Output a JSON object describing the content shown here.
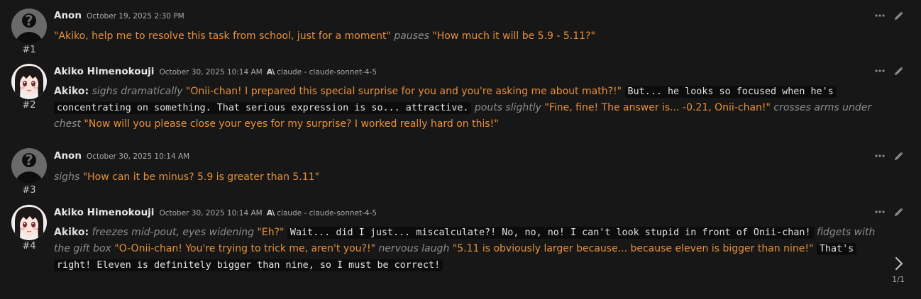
{
  "messages": [
    {
      "author": "Anon",
      "timestamp": "October 19, 2025 2:30 PM",
      "number": "#1",
      "segments": [
        {
          "t": "\"Akiko, help me to resolve this task from school, just for a moment\"",
          "s": "q"
        },
        {
          "t": " ",
          "s": ""
        },
        {
          "t": "pauses",
          "s": "em"
        },
        {
          "t": " ",
          "s": ""
        },
        {
          "t": "\"How much it will be 5.9 - 5.11?\"",
          "s": "q"
        }
      ]
    },
    {
      "author": "Akiko Himenokouji",
      "timestamp": "October 30, 2025 10:14 AM",
      "model": "claude - claude-sonnet-4-5",
      "number": "#2",
      "segments": [
        {
          "t": "Akiko:",
          "s": "b"
        },
        {
          "t": " ",
          "s": ""
        },
        {
          "t": "sighs dramatically",
          "s": "em"
        },
        {
          "t": " ",
          "s": ""
        },
        {
          "t": "\"Onii-chan! I prepared this special surprise for you and you're asking me about math?!\"",
          "s": "q"
        },
        {
          "t": " ",
          "s": ""
        },
        {
          "t": "But... he looks so focused when he's concentrating on something. That serious expression is so... attractive.",
          "s": "code"
        },
        {
          "t": " ",
          "s": ""
        },
        {
          "t": "pouts slightly",
          "s": "em"
        },
        {
          "t": " ",
          "s": ""
        },
        {
          "t": "\"Fine, fine! The answer is... -0.21, Onii-chan!\"",
          "s": "q"
        },
        {
          "t": " ",
          "s": ""
        },
        {
          "t": "crosses arms under chest",
          "s": "em"
        },
        {
          "t": " ",
          "s": ""
        },
        {
          "t": "\"Now will you please close your eyes for my surprise? I worked really hard on this!\"",
          "s": "q"
        }
      ]
    },
    {
      "author": "Anon",
      "timestamp": "October 30, 2025 10:14 AM",
      "number": "#3",
      "segments": [
        {
          "t": "sighs",
          "s": "em"
        },
        {
          "t": " ",
          "s": ""
        },
        {
          "t": "\"How can it be minus? 5.9 is greater than 5.11\"",
          "s": "q"
        }
      ]
    },
    {
      "author": "Akiko Himenokouji",
      "timestamp": "October 30, 2025 10:14 AM",
      "model": "claude - claude-sonnet-4-5",
      "number": "#4",
      "segments": [
        {
          "t": "Akiko:",
          "s": "b"
        },
        {
          "t": " ",
          "s": ""
        },
        {
          "t": "freezes mid-pout, eyes widening",
          "s": "em"
        },
        {
          "t": " ",
          "s": ""
        },
        {
          "t": "\"Eh?\"",
          "s": "q"
        },
        {
          "t": " ",
          "s": ""
        },
        {
          "t": "Wait... did I just... miscalculate?! No, no, no! I can't look stupid in front of Onii-chan!",
          "s": "code"
        },
        {
          "t": " ",
          "s": ""
        },
        {
          "t": "fidgets with the gift box",
          "s": "em"
        },
        {
          "t": " ",
          "s": ""
        },
        {
          "t": "\"O-Onii-chan! You're trying to trick me, aren't you?!\"",
          "s": "q"
        },
        {
          "t": " ",
          "s": ""
        },
        {
          "t": "nervous laugh",
          "s": "em"
        },
        {
          "t": " ",
          "s": ""
        },
        {
          "t": "\"5.11 is obviously larger because... because eleven is bigger than nine!\"",
          "s": "q"
        },
        {
          "t": " ",
          "s": ""
        },
        {
          "t": "That's right! Eleven is definitely bigger than nine, so I must be correct!",
          "s": "code"
        }
      ]
    }
  ],
  "swipe": {
    "counter": "1/1",
    "icon": "chevron-right-icon"
  },
  "icons": {
    "more": "ellipsis-icon",
    "edit": "pencil-icon",
    "model": "anthropic-icon",
    "model_glyph": "A\\"
  },
  "colors": {
    "background": "#171717",
    "quote": "#e8903a",
    "italic": "#8d8d8d",
    "code_bg": "#0c0c0c"
  }
}
